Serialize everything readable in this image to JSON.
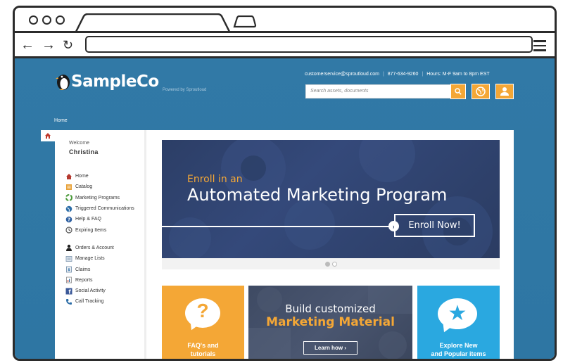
{
  "header": {
    "brand": "SampleCo",
    "powered_by": "Powered by Sproutloud",
    "email": "customerservice@sproutloud.com",
    "phone": "877-634-9260",
    "hours": "Hours: M-F 9am to 8pm EST",
    "search_placeholder": "Search assets, documents"
  },
  "breadcrumb": "Home",
  "sidebar": {
    "welcome": "Welcome",
    "user": "Christina",
    "items_primary": [
      {
        "label": "Home",
        "icon": "home-icon"
      },
      {
        "label": "Catalog",
        "icon": "catalog-icon"
      },
      {
        "label": "Marketing Programs",
        "icon": "recycle-icon"
      },
      {
        "label": "Triggered Communications",
        "icon": "globe-icon"
      },
      {
        "label": "Help & FAQ",
        "icon": "help-icon"
      },
      {
        "label": "Expiring Items",
        "icon": "clock-icon"
      }
    ],
    "items_secondary": [
      {
        "label": "Orders & Account",
        "icon": "person-icon"
      },
      {
        "label": "Manage Lists",
        "icon": "list-icon"
      },
      {
        "label": "Claims",
        "icon": "claims-icon"
      },
      {
        "label": "Reports",
        "icon": "report-icon"
      },
      {
        "label": "Social Activity",
        "icon": "facebook-icon"
      },
      {
        "label": "Call Tracking",
        "icon": "phone-icon"
      }
    ]
  },
  "banner": {
    "line1": "Enroll in an",
    "line2": "Automated Marketing Program",
    "button": "Enroll Now!",
    "slides": 2,
    "active_slide": 1
  },
  "tiles": {
    "faq": {
      "line1": "FAQ's and",
      "line2": "tutorials"
    },
    "marketing": {
      "line1": "Build customized",
      "line2": "Marketing Material",
      "button": "Learn how ›"
    },
    "explore": {
      "line1": "Explore New",
      "line2": "and Popular items"
    }
  },
  "colors": {
    "page_bg": "#3179a6",
    "accent": "#f4a736",
    "blue_tile": "#2aa8e0",
    "banner": "#2c3e66"
  }
}
